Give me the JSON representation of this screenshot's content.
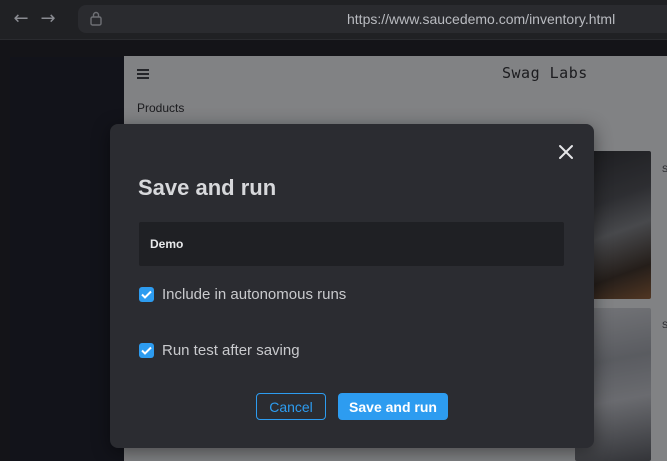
{
  "browser": {
    "url": "https://www.saucedemo.com/inventory.html",
    "icons": {
      "back": "arrow-left-icon",
      "forward": "arrow-right-icon",
      "lock": "lock-icon"
    }
  },
  "app": {
    "logo": "Swag Labs",
    "section_title": "Products",
    "menu_icon": "hamburger-menu-icon",
    "products": [
      {
        "text": "S"
      },
      {
        "text": "S"
      }
    ]
  },
  "modal": {
    "title": "Save and run",
    "name_value": "Demo",
    "checkboxes": [
      {
        "label": "Include in autonomous runs",
        "checked": true
      },
      {
        "label": "Run test after saving",
        "checked": true
      }
    ],
    "cancel_label": "Cancel",
    "save_label": "Save and run",
    "close_icon": "close-icon"
  },
  "colors": {
    "accent": "#2d9cf0",
    "modal_bg": "#2b2c31",
    "input_bg": "#1f2024"
  }
}
